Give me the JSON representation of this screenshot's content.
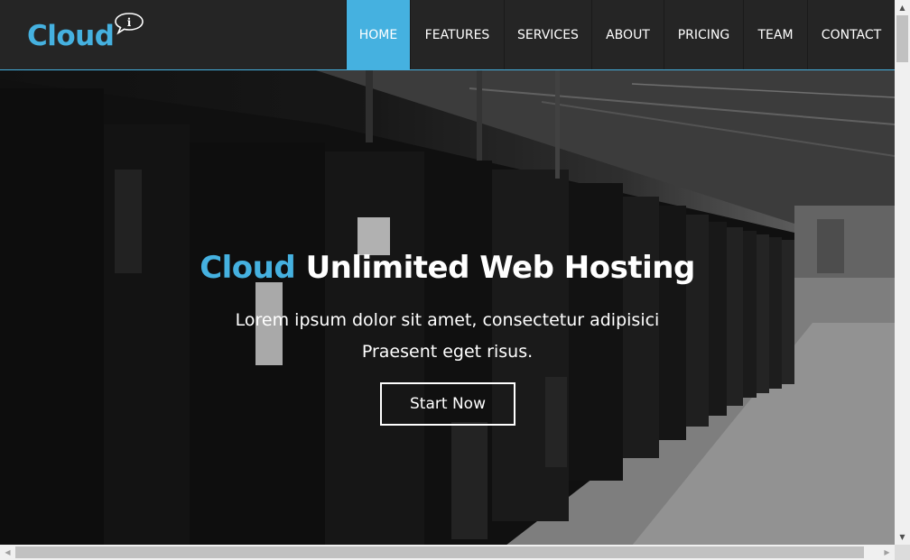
{
  "brand": {
    "name": "Cloud",
    "bubble_glyph": "i",
    "accent_color": "#45b1e0"
  },
  "nav": {
    "items": [
      {
        "label": "HOME",
        "active": true
      },
      {
        "label": "FEATURES",
        "active": false
      },
      {
        "label": "SERVICES",
        "active": false
      },
      {
        "label": "ABOUT",
        "active": false
      },
      {
        "label": "PRICING",
        "active": false
      },
      {
        "label": "TEAM",
        "active": false
      },
      {
        "label": "CONTACT",
        "active": false
      }
    ]
  },
  "hero": {
    "title_accent": "Cloud",
    "title_rest": "Unlimited Web Hosting",
    "subtitle_line1": "Lorem ipsum dolor sit amet, consectetur adipisici",
    "subtitle_line2": "Praesent eget risus.",
    "button_label": "Start Now"
  },
  "scrollbars": {
    "up_icon": "triangle-up",
    "down_icon": "triangle-down",
    "left_icon": "triangle-left",
    "right_icon": "triangle-right"
  }
}
